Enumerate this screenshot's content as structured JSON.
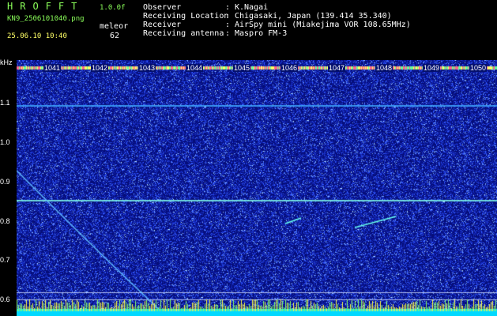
{
  "header": {
    "app_title": "HROFFT",
    "version": "1.0.0f",
    "filename": "KN9_2506101040.png",
    "mode": "meleor",
    "datetime": "25.06.10 10:40",
    "count": "62",
    "meta": [
      {
        "label": "Observer",
        "value": "K.Nagai"
      },
      {
        "label": "Receiving Location",
        "value": "Chigasaki, Japan (139.414 35.340)"
      },
      {
        "label": "Receiver",
        "value": "AirSpy mini (Miakejima VOR 108.65MHz)"
      },
      {
        "label": "Receiving antenna",
        "value": "Maspro FM-3"
      }
    ],
    "separator": ":"
  },
  "spectrogram": {
    "y_unit": "kHz",
    "y_ticks": [
      "1.1",
      "1.0",
      "0.9",
      "0.8",
      "0.7",
      "0.6"
    ],
    "x_ticks": [
      "1041",
      "1042",
      "1043",
      "1044",
      "1045",
      "1046",
      "1047",
      "1048",
      "1049",
      "1050"
    ],
    "colors": {
      "background": "#060e7a",
      "noise": "#3a5cff",
      "signal": "#66ffee",
      "bottom_band": "#00d8ff",
      "label_text": "#ffffff",
      "header_green": "#8bff5a",
      "header_yellow": "#ffff66"
    }
  }
}
